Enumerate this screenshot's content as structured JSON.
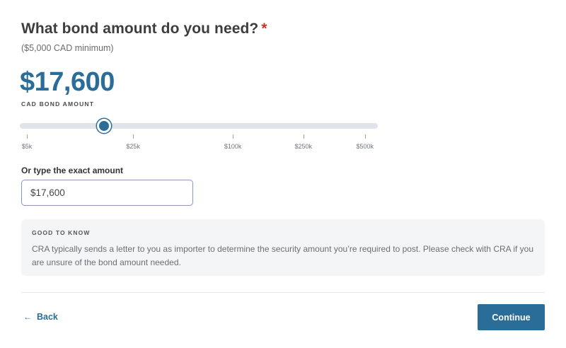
{
  "question": {
    "title": "What bond amount do you need?",
    "required_marker": "*",
    "subtitle": "($5,000 CAD minimum)"
  },
  "amount": {
    "display": "$17,600",
    "caption": "CAD BOND AMOUNT"
  },
  "slider": {
    "value_fraction": 0.224,
    "ticks": [
      {
        "label": "$5k",
        "fraction": 0.0
      },
      {
        "label": "$25k",
        "fraction": 0.309
      },
      {
        "label": "$100k",
        "fraction": 0.599
      },
      {
        "label": "$250k",
        "fraction": 0.804
      },
      {
        "label": "$500k",
        "fraction": 0.983
      }
    ]
  },
  "exact_input": {
    "label": "Or type the exact amount",
    "value": "$17,600"
  },
  "info": {
    "heading": "GOOD TO KNOW",
    "text": "CRA typically sends a letter to you as importer to determine the security amount you’re required to post. Please check with CRA if you are unsure of the bond amount needed."
  },
  "nav": {
    "back_icon": "arrow-left-icon",
    "back_label": "Back",
    "continue_label": "Continue"
  },
  "colors": {
    "accent": "#2b6d99",
    "required": "#c0392b",
    "track": "#dfe4ea",
    "info_bg": "#f4f5f7"
  }
}
